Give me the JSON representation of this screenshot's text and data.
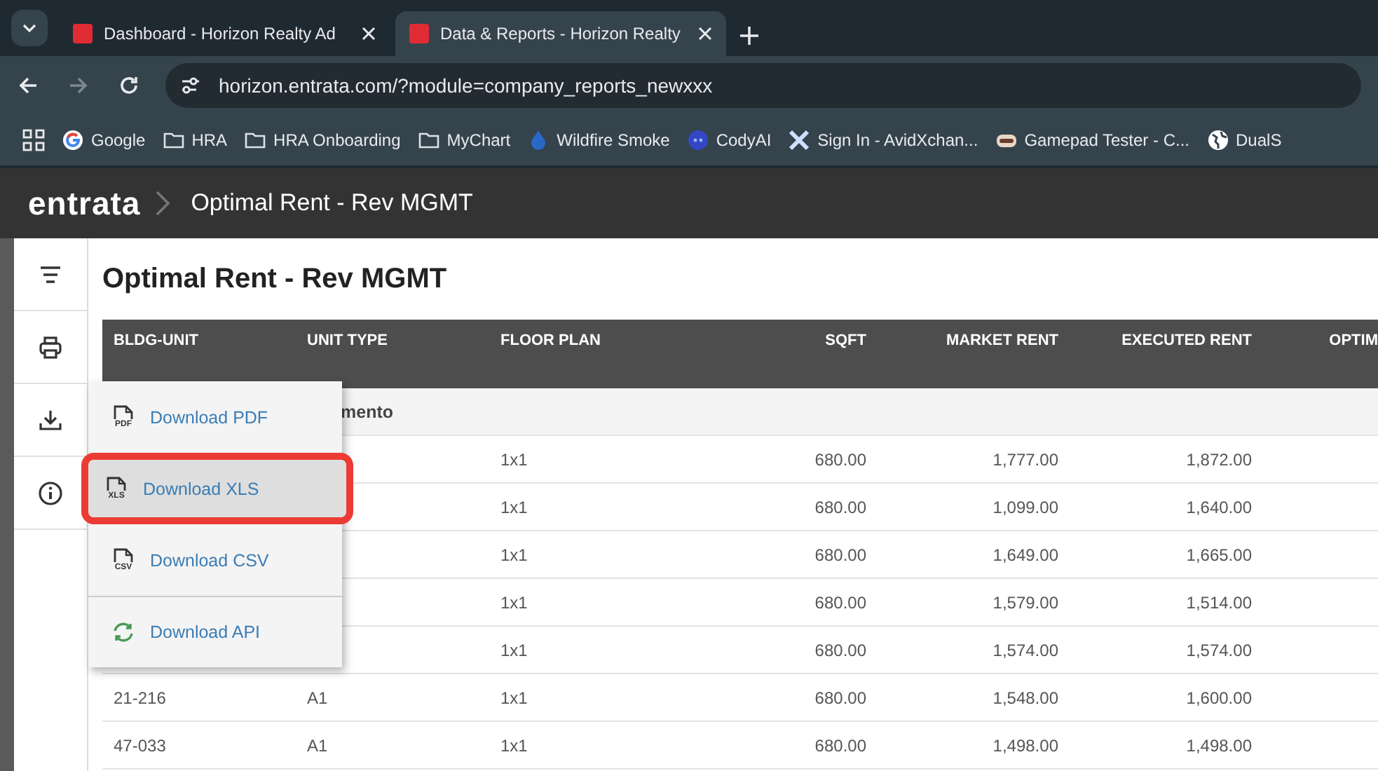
{
  "browser": {
    "tabs": [
      {
        "title": "Dashboard - Horizon Realty Ad",
        "selected": false
      },
      {
        "title": "Data & Reports - Horizon Realty",
        "selected": true
      }
    ],
    "url": "horizon.entrata.com/?module=company_reports_newxxx",
    "bookmarks": [
      {
        "label": "Google",
        "kind": "google"
      },
      {
        "label": "HRA",
        "kind": "folder"
      },
      {
        "label": "HRA Onboarding",
        "kind": "folder"
      },
      {
        "label": "MyChart",
        "kind": "folder"
      },
      {
        "label": "Wildfire Smoke",
        "kind": "drop"
      },
      {
        "label": "CodyAI",
        "kind": "bot"
      },
      {
        "label": "Sign In - AvidXchan...",
        "kind": "x"
      },
      {
        "label": "Gamepad Tester - C...",
        "kind": "gamepad"
      },
      {
        "label": "DualS",
        "kind": "globe"
      }
    ]
  },
  "header": {
    "logo": "entrata",
    "breadcrumb": "Optimal Rent - Rev MGMT"
  },
  "sidebar": {
    "items": [
      {
        "kind": "menu"
      },
      {
        "kind": "print"
      },
      {
        "kind": "download"
      },
      {
        "kind": "info"
      }
    ]
  },
  "report": {
    "title": "Optimal Rent - Rev MGMT",
    "columns": [
      {
        "label": "BLDG-UNIT",
        "numeric": false
      },
      {
        "label": "UNIT TYPE",
        "numeric": false
      },
      {
        "label": "FLOOR PLAN",
        "numeric": false
      },
      {
        "label": "SQFT",
        "numeric": true
      },
      {
        "label": "MARKET RENT",
        "numeric": true
      },
      {
        "label": "EXECUTED RENT",
        "numeric": true
      },
      {
        "label": "OPTIM",
        "numeric": true
      }
    ],
    "group_label": "mento",
    "rows": [
      {
        "cells": [
          "",
          "",
          "1x1",
          "680.00",
          "1,777.00",
          "1,872.00"
        ]
      },
      {
        "cells": [
          "",
          "",
          "1x1",
          "680.00",
          "1,099.00",
          "1,640.00"
        ]
      },
      {
        "cells": [
          "",
          "",
          "1x1",
          "680.00",
          "1,649.00",
          "1,665.00"
        ]
      },
      {
        "cells": [
          "",
          "",
          "1x1",
          "680.00",
          "1,579.00",
          "1,514.00"
        ]
      },
      {
        "cells": [
          "",
          "",
          "1x1",
          "680.00",
          "1,574.00",
          "1,574.00"
        ]
      },
      {
        "cells": [
          "21-216",
          "A1",
          "1x1",
          "680.00",
          "1,548.00",
          "1,600.00"
        ]
      },
      {
        "cells": [
          "47-033",
          "A1",
          "1x1",
          "680.00",
          "1,498.00",
          "1,498.00"
        ]
      }
    ]
  },
  "download_menu": {
    "items": [
      {
        "label": "Download PDF",
        "kind": "file",
        "icon_text": "PDF",
        "selected": false
      },
      {
        "label": "Download XLS",
        "kind": "file",
        "icon_text": "XLS",
        "selected": true
      },
      {
        "label": "Download CSV",
        "kind": "file",
        "icon_text": "CSV",
        "selected": false
      },
      {
        "label": "Download API",
        "kind": "sync",
        "selected": false
      }
    ]
  }
}
